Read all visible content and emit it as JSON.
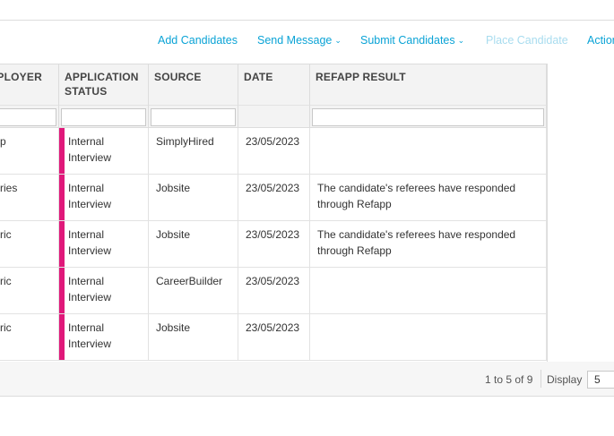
{
  "toolbar": {
    "add_candidates": "Add Candidates",
    "send_message": "Send Message",
    "submit_candidates": "Submit Candidates",
    "place_candidate": "Place Candidate",
    "actions": "Actions"
  },
  "columns": {
    "employer": "EMPLOYER",
    "application_status": "APPLICATION STATUS",
    "source": "SOURCE",
    "date": "DATE",
    "refapp_result": "REFAPP RESULT"
  },
  "rows": [
    {
      "employer": "p",
      "status": "Internal Interview",
      "source": "SimplyHired",
      "date": "23/05/2023",
      "refapp": ""
    },
    {
      "employer": "ries",
      "status": "Internal Interview",
      "source": "Jobsite",
      "date": "23/05/2023",
      "refapp": "The candidate's referees have responded through Refapp"
    },
    {
      "employer": "ric",
      "status": "Internal Interview",
      "source": "Jobsite",
      "date": "23/05/2023",
      "refapp": "The candidate's referees have responded through Refapp"
    },
    {
      "employer": "ric",
      "status": "Internal Interview",
      "source": "CareerBuilder",
      "date": "23/05/2023",
      "refapp": ""
    },
    {
      "employer": "ric",
      "status": "Internal Interview",
      "source": "Jobsite",
      "date": "23/05/2023",
      "refapp": ""
    }
  ],
  "footer": {
    "pagination": "1 to 5 of 9",
    "display_label": "Display",
    "display_value": "5"
  },
  "colors": {
    "link": "#0aa3d6",
    "status_marker": "#e0187a"
  }
}
